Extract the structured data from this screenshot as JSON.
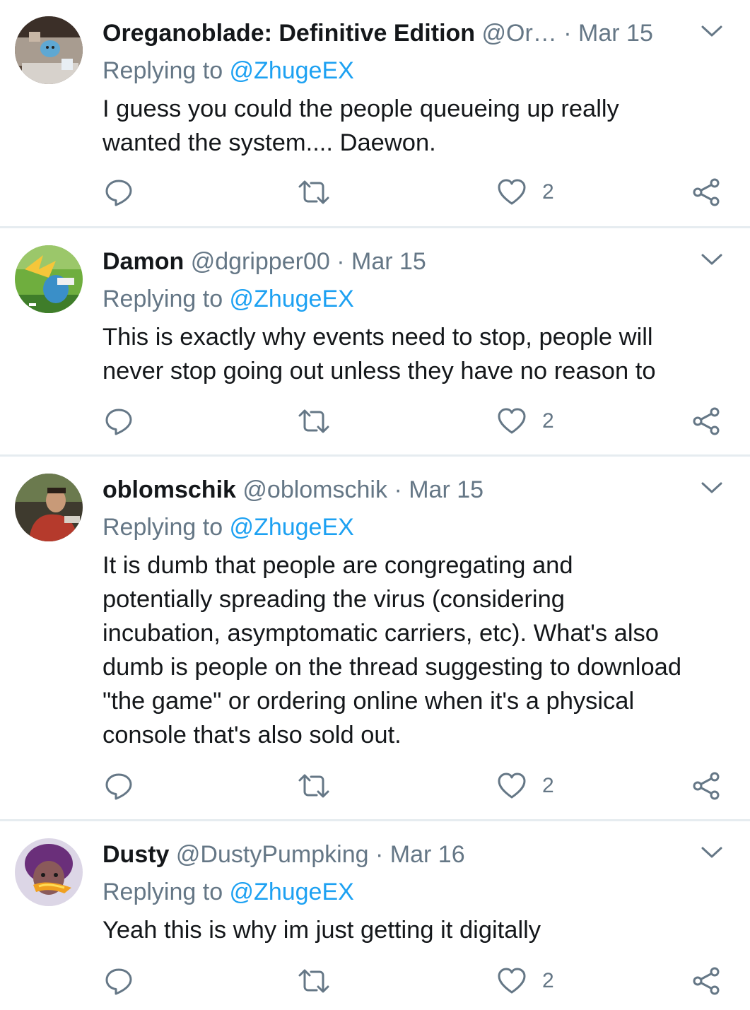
{
  "colors": {
    "text": "#14171a",
    "secondary": "#657786",
    "link": "#1da1f2",
    "divider": "#e6ecf0"
  },
  "icons": {
    "reply": "reply-icon",
    "retweet": "retweet-icon",
    "like": "heart-icon",
    "share": "share-icon",
    "more": "chevron-down-icon"
  },
  "tweets": [
    {
      "name": "Oreganoblade: Definitive Edition",
      "handle": "@Or…",
      "separator": "·",
      "date": "Mar 15",
      "replying_prefix": "Replying to ",
      "replying_to": "@ZhugeEX",
      "lines": [
        "I guess you could the people queueing up really",
        "wanted the system.... Daewon."
      ],
      "likes": "2"
    },
    {
      "name": "Damon",
      "handle": "@dgripper00",
      "separator": "·",
      "date": "Mar 15",
      "replying_prefix": "Replying to ",
      "replying_to": "@ZhugeEX",
      "lines": [
        "This is exactly why events need to stop, people will",
        "never stop going out unless they have no reason to"
      ],
      "likes": "2"
    },
    {
      "name": "oblomschik",
      "handle": "@oblomschik",
      "separator": "·",
      "date": "Mar 15",
      "replying_prefix": "Replying to ",
      "replying_to": "@ZhugeEX",
      "lines": [
        "It is dumb that people are congregating and",
        "potentially spreading the virus (considering",
        "incubation, asymptomatic carriers, etc).  What's also",
        "dumb is people on the thread suggesting to download",
        "\"the game\" or ordering online when it's a physical",
        "console that's also sold out."
      ],
      "likes": "2"
    },
    {
      "name": "Dusty",
      "handle": "@DustyPumpking",
      "separator": "·",
      "date": "Mar 16",
      "replying_prefix": "Replying to ",
      "replying_to": "@ZhugeEX",
      "lines": [
        "Yeah this is why im just getting it digitally"
      ],
      "likes": "2"
    }
  ]
}
